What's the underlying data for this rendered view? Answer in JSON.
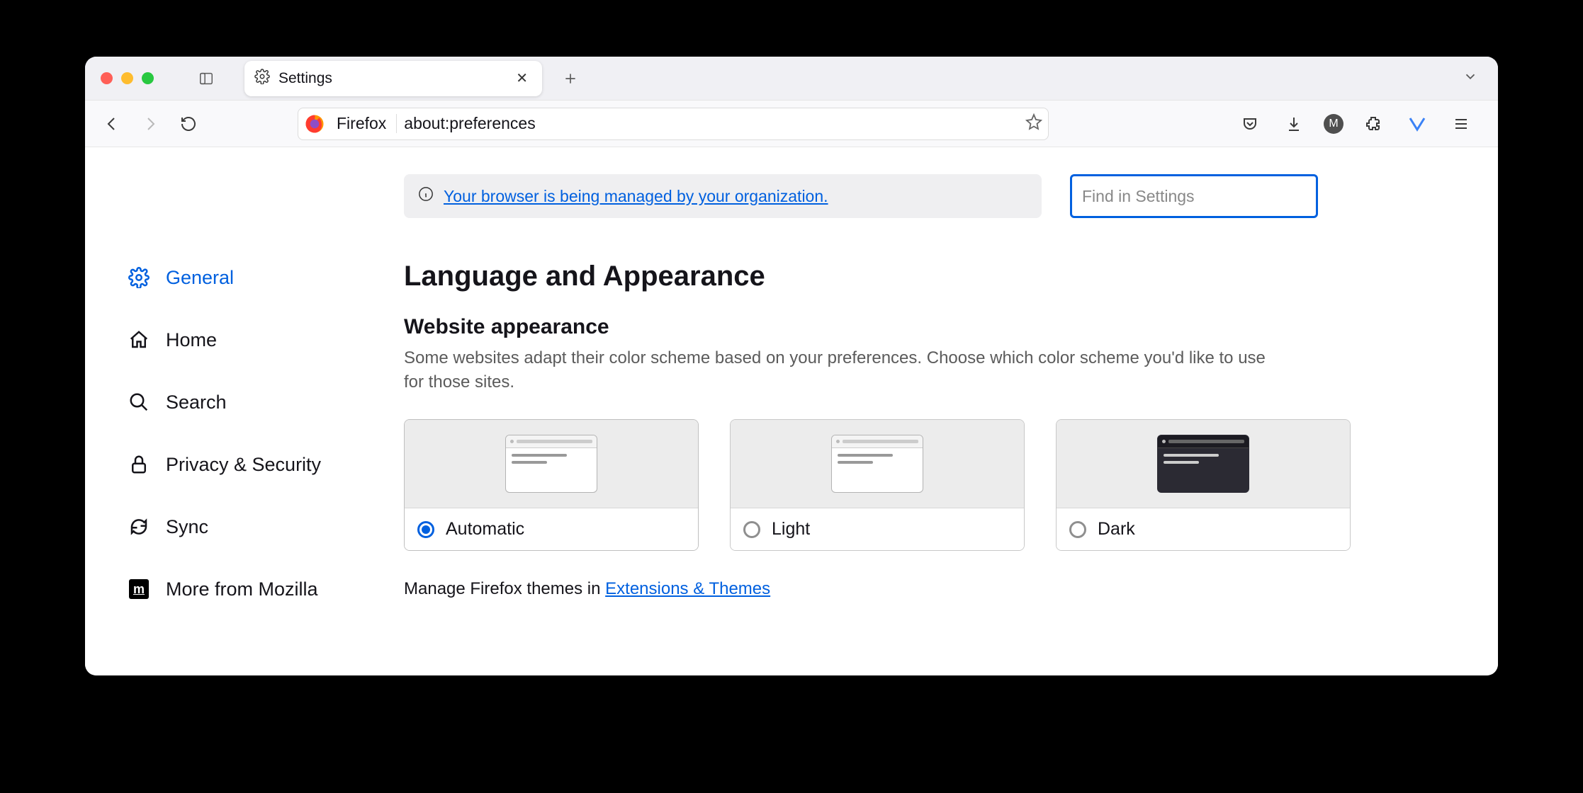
{
  "tab": {
    "title": "Settings"
  },
  "urlbar": {
    "brand": "Firefox",
    "url": "about:preferences"
  },
  "account_initial": "M",
  "search": {
    "placeholder": "Find in Settings"
  },
  "banner": {
    "text": "Your browser is being managed by your organization."
  },
  "sidebar": {
    "items": [
      {
        "label": "General",
        "icon": "gear",
        "active": true
      },
      {
        "label": "Home",
        "icon": "home",
        "active": false
      },
      {
        "label": "Search",
        "icon": "search",
        "active": false
      },
      {
        "label": "Privacy & Security",
        "icon": "lock",
        "active": false
      },
      {
        "label": "Sync",
        "icon": "sync",
        "active": false
      },
      {
        "label": "More from Mozilla",
        "icon": "mozilla",
        "active": false
      }
    ]
  },
  "main": {
    "heading": "Language and Appearance",
    "subheading": "Website appearance",
    "description": "Some websites adapt their color scheme based on your preferences. Choose which color scheme you'd like to use for those sites.",
    "options": [
      {
        "label": "Automatic",
        "selected": true,
        "variant": "auto"
      },
      {
        "label": "Light",
        "selected": false,
        "variant": "light"
      },
      {
        "label": "Dark",
        "selected": false,
        "variant": "dark"
      }
    ],
    "themes_prefix": "Manage Firefox themes in ",
    "themes_link": "Extensions & Themes"
  }
}
